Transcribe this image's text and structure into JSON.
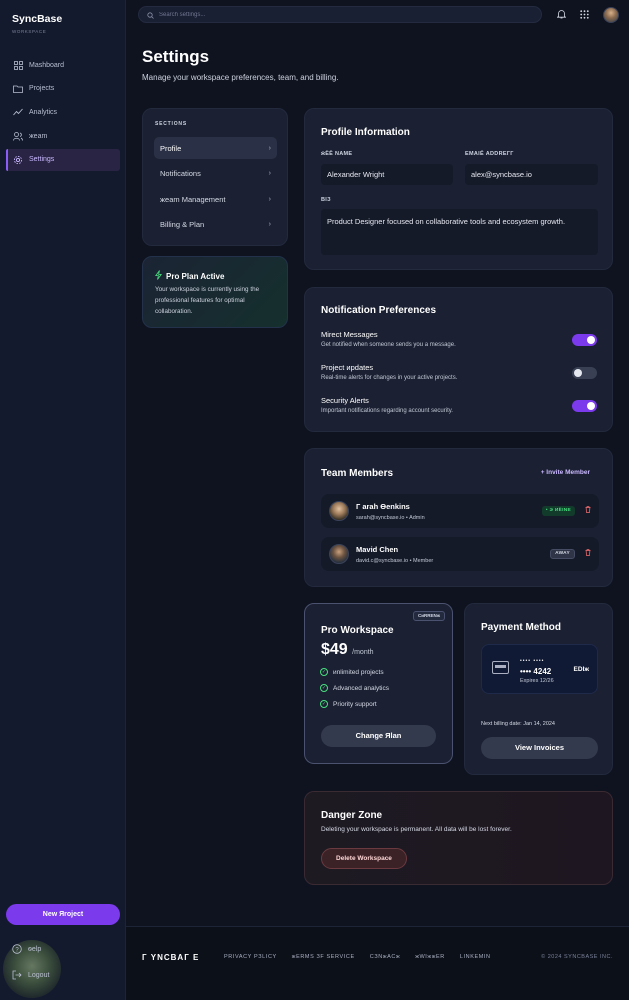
{
  "app": {
    "name": "SyncBase",
    "subtitle": "WORKSPACE"
  },
  "sidebar": {
    "items": [
      {
        "label": "Mashboard",
        "icon": "dashboard-icon"
      },
      {
        "label": "Projects",
        "icon": "folder-icon"
      },
      {
        "label": "Analytics",
        "icon": "chart-icon"
      },
      {
        "label": "жeam",
        "icon": "users-icon"
      },
      {
        "label": "Settings",
        "icon": "gear-icon",
        "active": true
      }
    ],
    "new_project": "New Яroject",
    "help": "ѳelp",
    "logout": "Logout"
  },
  "topbar": {
    "search_placeholder": "Search settings..."
  },
  "page": {
    "title": "Settings",
    "subtitle": "Manage your workspace preferences, team, and billing."
  },
  "sections": {
    "label": "SECTIONS",
    "items": [
      "Profile",
      "Notifications",
      "жeam Management",
      "Billing & Plan"
    ]
  },
  "pro_plan": {
    "title": "Pro Plan Active",
    "text": "Your workspace is currently using the professional features for optimal collaboration."
  },
  "profile": {
    "title": "Profile Information",
    "name_label": "ӝЁЁ NAME",
    "name_value": "Alexander Wright",
    "email_label": "EMAIЁ ADDREГГ",
    "email_value": "alex@syncbase.io",
    "bio_label": "BIЗ",
    "bio_value": "Product Designer focused on collaborative tools and ecosystem growth."
  },
  "notifications": {
    "title": "Notification Preferences",
    "items": [
      {
        "title": "Mirect Messages",
        "desc": "Get notified when someone sends you a message.",
        "on": true
      },
      {
        "title": "Project иpdates",
        "desc": "Real-time alerts for changes in your active projects.",
        "on": false
      },
      {
        "title": "Security Alerts",
        "desc": "Important notifications regarding account security.",
        "on": true
      }
    ]
  },
  "team": {
    "title": "Team Members",
    "invite": "+ Invite Member",
    "members": [
      {
        "name": "Г arah Өenkins",
        "sub": "sarah@syncbase.io • Admin",
        "status": "• Э ИЁІNE",
        "status_type": "online"
      },
      {
        "name": "Mavid Chen",
        "sub": "david.c@syncbase.io • Member",
        "status": "AWAY",
        "status_type": "away"
      }
    ]
  },
  "plan": {
    "badge": "CиRRENж",
    "name": "Pro Workspace",
    "price": "$49",
    "per": "/month",
    "features": [
      "иnlimited projects",
      "Advanced analytics",
      "Priority support"
    ],
    "change_button": "Change Яlan"
  },
  "payment": {
    "title": "Payment Method",
    "dots": "•••• ••••",
    "number": "•••• 4242",
    "expires": "Expires 12/26",
    "edit": "EDІж",
    "next_billing": "Next billing date: Jan 14, 2024",
    "view_invoices": "View Invoices"
  },
  "danger": {
    "title": "Danger Zone",
    "text": "Deleting your workspace is permanent. All data will be lost forever.",
    "button": "Delete Workspace"
  },
  "footer": {
    "brand": "Г YNCBAГ E",
    "links": [
      "PRIVACY PЗLICY",
      "жERMS ЗF SERVICE",
      "CЗNжACж",
      "жWIжжER",
      "LINKEMIN"
    ],
    "copyright": "© 2024 SYNCBASE INC."
  },
  "colors": {
    "accent": "#7c3aed",
    "background": "#0f1320",
    "card": "#1b2032",
    "success": "#4ade80",
    "danger": "#f87171"
  }
}
